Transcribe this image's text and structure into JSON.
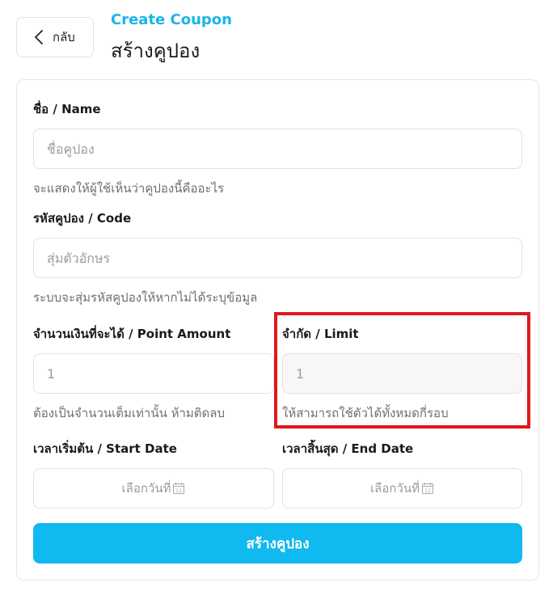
{
  "header": {
    "back_label": "กลับ",
    "subtitle": "Create Coupon",
    "title": "สร้างคูปอง"
  },
  "form": {
    "name": {
      "label": "ชื่อ / Name",
      "placeholder": "ชื่อคูปอง",
      "hint": "จะแสดงให้ผู้ใช้เห็นว่าคูปองนี้คืออะไร"
    },
    "code": {
      "label": "รหัสคูปอง / Code",
      "placeholder": "สุ่มตัวอักษร",
      "hint": "ระบบจะสุ่มรหัสคูปองให้หากไม่ได้ระบุข้อมูล"
    },
    "point_amount": {
      "label": "จำนวนเงินที่จะได้ / Point Amount",
      "placeholder": "1",
      "hint": "ต้องเป็นจำนวนเต็มเท่านั้น ห้ามติดลบ"
    },
    "limit": {
      "label": "จำกัด / Limit",
      "placeholder": "1",
      "hint": "ให้สามารถใช้ตัวได้ทั้งหมดกี่รอบ"
    },
    "start_date": {
      "label": "เวลาเริ่มต้น / Start Date",
      "placeholder": "เลือกวันที่"
    },
    "end_date": {
      "label": "เวลาสิ้นสุด / End Date",
      "placeholder": "เลือกวันที่"
    },
    "submit_label": "สร้างคูปอง"
  },
  "icons": {
    "back": "chevron-left-icon",
    "calendar": "calendar-icon"
  },
  "colors": {
    "accent": "#10b9ef",
    "subtitle": "#1ab4e8",
    "highlight": "#e0181b"
  }
}
